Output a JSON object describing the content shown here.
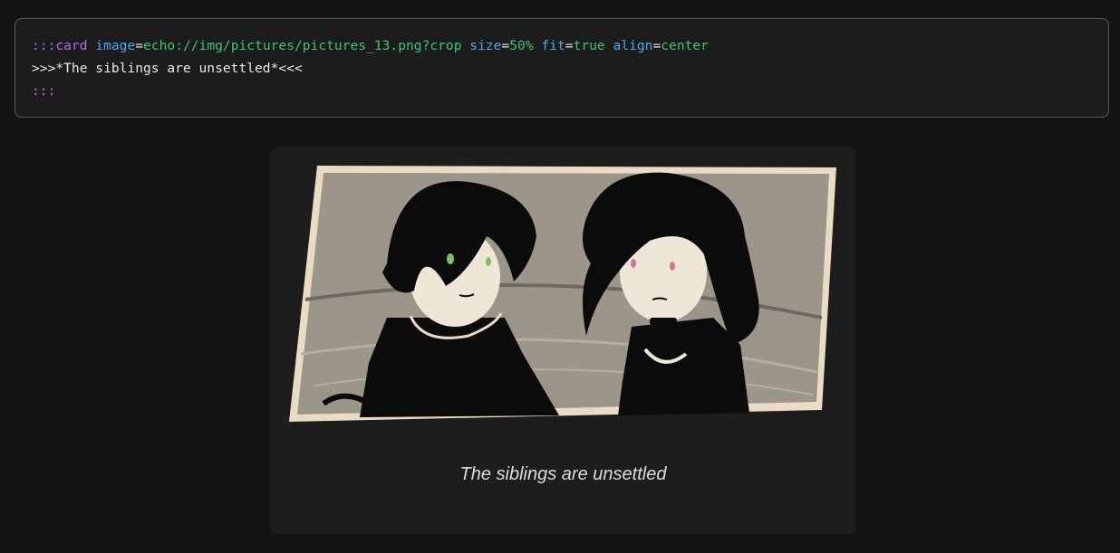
{
  "source": {
    "line1": {
      "open": ":::",
      "directive": "card",
      "attr_image_name": "image",
      "attr_image_value": "echo://img/pictures/pictures_13.png?crop",
      "attr_size_name": "size",
      "attr_size_value": "50%",
      "attr_fit_name": "fit",
      "attr_fit_value": "true",
      "attr_align_name": "align",
      "attr_align_value": "center",
      "eq": "="
    },
    "line2": ">>>*The siblings are unsettled*<<<",
    "line3": ":::"
  },
  "card": {
    "caption": "The siblings are unsettled"
  },
  "colors": {
    "background": "#141414",
    "code_bg": "#1c1c1c",
    "syntax_purple": "#b46cf0",
    "syntax_blue": "#4aa6f0",
    "syntax_green": "#3fc27a",
    "card_bg": "#1d1d1d"
  }
}
